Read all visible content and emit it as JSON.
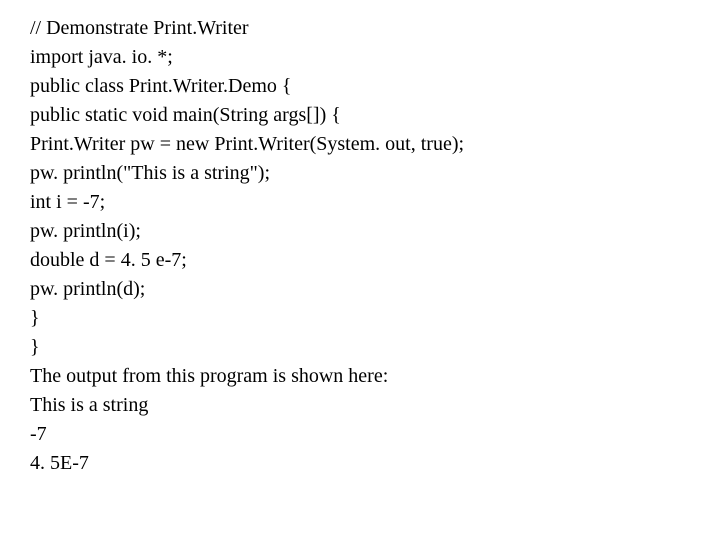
{
  "lines": [
    "// Demonstrate Print.Writer",
    "import java. io. *;",
    "public class Print.Writer.Demo {",
    "public static void main(String args[]) {",
    "Print.Writer pw = new Print.Writer(System. out, true);",
    "pw. println(\"This is a string\");",
    "int i = -7;",
    "pw. println(i);",
    "double d = 4. 5 e-7;",
    "pw. println(d);",
    "}",
    "}",
    "The output from this program is shown here:",
    "This is a string",
    "-7",
    "4. 5E-7"
  ]
}
